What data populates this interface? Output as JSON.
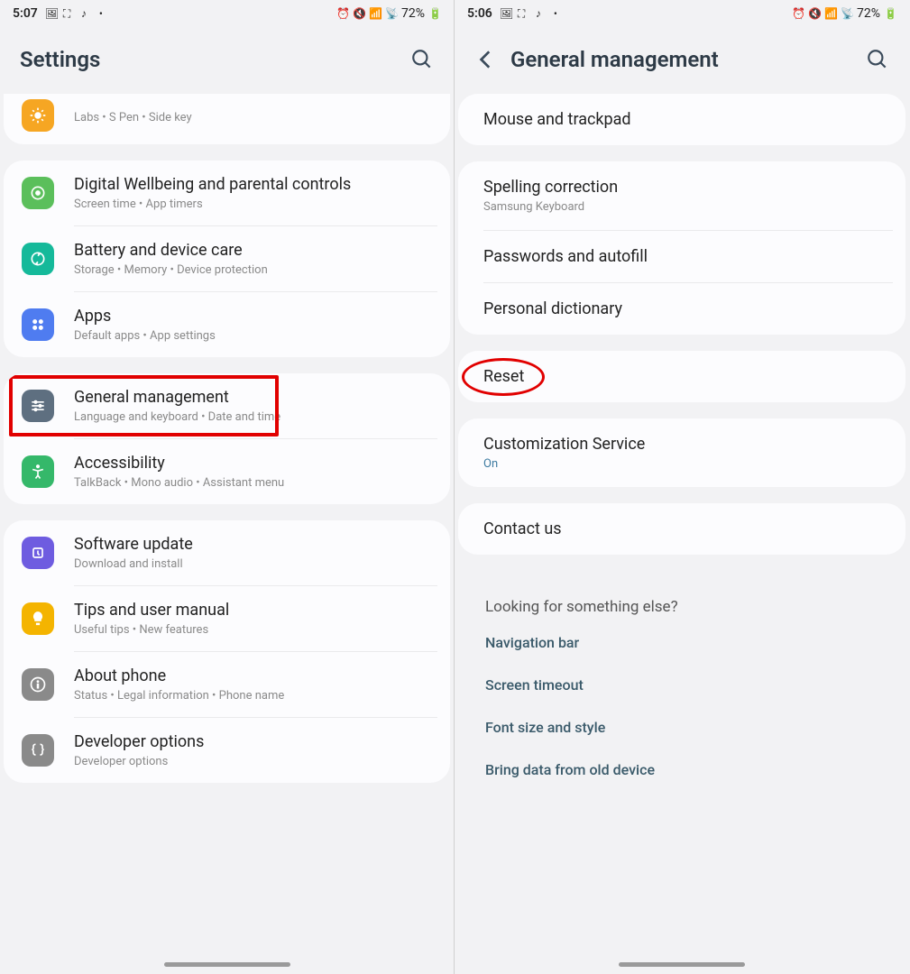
{
  "left": {
    "status": {
      "time": "5:07",
      "battery": "72%"
    },
    "header": {
      "title": "Settings"
    },
    "group_partial": {
      "sub": "Labs  •  S Pen  •  Side key"
    },
    "group1": [
      {
        "label": "Digital Wellbeing and parental controls",
        "sub": "Screen time  •  App timers",
        "icon": "wellbeing-icon",
        "color": "ic-green"
      },
      {
        "label": "Battery and device care",
        "sub": "Storage  •  Memory  •  Device protection",
        "icon": "battery-care-icon",
        "color": "ic-teal"
      },
      {
        "label": "Apps",
        "sub": "Default apps  •  App settings",
        "icon": "apps-icon",
        "color": "ic-blue"
      }
    ],
    "group2": [
      {
        "label": "General management",
        "sub": "Language and keyboard  •  Date and time",
        "icon": "sliders-icon",
        "color": "ic-slate",
        "highlight": true
      },
      {
        "label": "Accessibility",
        "sub": "TalkBack  •  Mono audio  •  Assistant menu",
        "icon": "accessibility-icon",
        "color": "ic-green2"
      }
    ],
    "group3": [
      {
        "label": "Software update",
        "sub": "Download and install",
        "icon": "update-icon",
        "color": "ic-purple"
      },
      {
        "label": "Tips and user manual",
        "sub": "Useful tips  •  New features",
        "icon": "lightbulb-icon",
        "color": "ic-yell"
      },
      {
        "label": "About phone",
        "sub": "Status  •  Legal information  •  Phone name",
        "icon": "info-icon",
        "color": "ic-gray"
      },
      {
        "label": "Developer options",
        "sub": "Developer options",
        "icon": "braces-icon",
        "color": "ic-gray2"
      }
    ]
  },
  "right": {
    "status": {
      "time": "5:06",
      "battery": "72%"
    },
    "header": {
      "title": "General management"
    },
    "card1": [
      {
        "label": "Mouse and trackpad"
      }
    ],
    "card2": [
      {
        "label": "Spelling correction",
        "sub": "Samsung Keyboard"
      },
      {
        "label": "Passwords and autofill"
      },
      {
        "label": "Personal dictionary"
      }
    ],
    "card3": [
      {
        "label": "Reset",
        "ellipse": true
      }
    ],
    "card4": [
      {
        "label": "Customization Service",
        "sub": "On",
        "subcolor": "#3c7aa0"
      }
    ],
    "card5": [
      {
        "label": "Contact us"
      }
    ],
    "suggest": {
      "heading": "Looking for something else?",
      "links": [
        "Navigation bar",
        "Screen timeout",
        "Font size and style",
        "Bring data from old device"
      ]
    }
  }
}
